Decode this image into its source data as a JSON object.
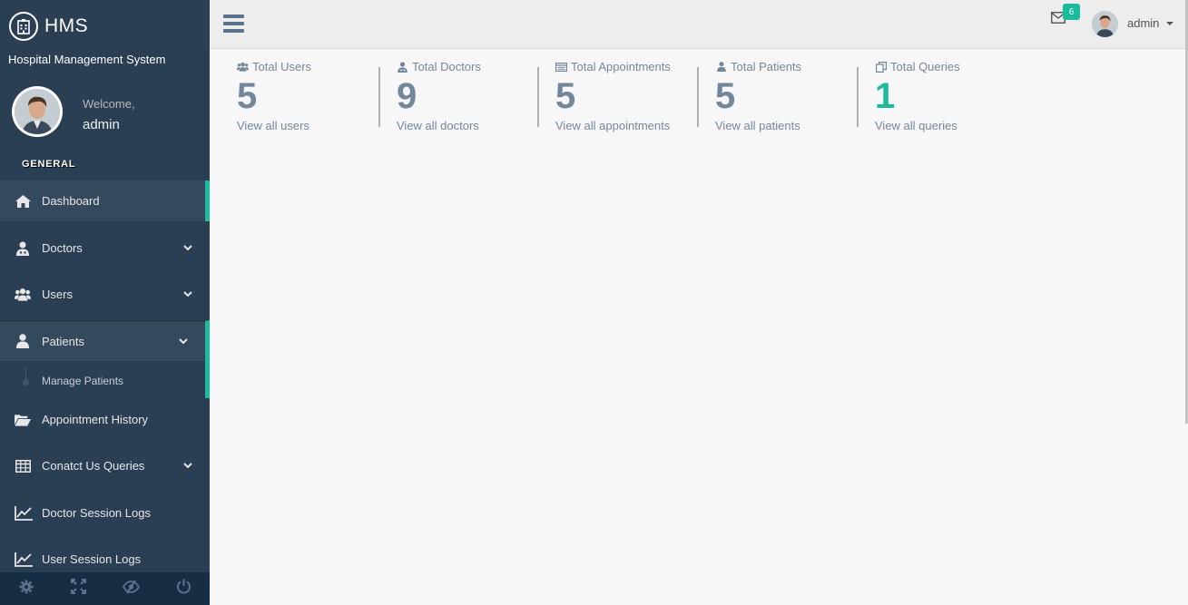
{
  "brand": {
    "name": "HMS",
    "subtitle": "Hospital Management System"
  },
  "profile": {
    "welcome": "Welcome,",
    "name": "admin"
  },
  "sidebar": {
    "section_title": "GENERAL",
    "items": [
      {
        "label": "Dashboard",
        "icon": "home-icon"
      },
      {
        "label": "Doctors",
        "icon": "user-md-icon"
      },
      {
        "label": "Users",
        "icon": "users-icon"
      },
      {
        "label": "Patients",
        "icon": "user-icon"
      },
      {
        "label": "Appointment History",
        "icon": "folder-open-icon"
      },
      {
        "label": "Conatct Us Queries",
        "icon": "table-icon"
      },
      {
        "label": "Doctor Session Logs",
        "icon": "line-chart-icon"
      },
      {
        "label": "User Session Logs",
        "icon": "line-chart-icon"
      }
    ],
    "submenu": {
      "label": "Manage Patients"
    },
    "footer_icons": [
      "settings-icon",
      "fullscreen-icon",
      "eye-slash-icon",
      "power-icon"
    ]
  },
  "topnav": {
    "mail_badge": "6",
    "user_name": "admin"
  },
  "tiles": [
    {
      "title": "Total Users",
      "count": "5",
      "link": "View all users",
      "icon": "users-icon"
    },
    {
      "title": "Total Doctors",
      "count": "9",
      "link": "View all doctors",
      "icon": "user-md-icon"
    },
    {
      "title": "Total Appointments",
      "count": "5",
      "link": "View all appointments",
      "icon": "list-icon"
    },
    {
      "title": "Total Patients",
      "count": "5",
      "link": "View all patients",
      "icon": "user-icon"
    },
    {
      "title": "Total Queries",
      "count": "1",
      "link": "View all queries",
      "icon": "copy-icon"
    }
  ],
  "colors": {
    "sidebar": "#2a3f54",
    "accent": "#1abb9c",
    "text_muted": "#73879c"
  }
}
